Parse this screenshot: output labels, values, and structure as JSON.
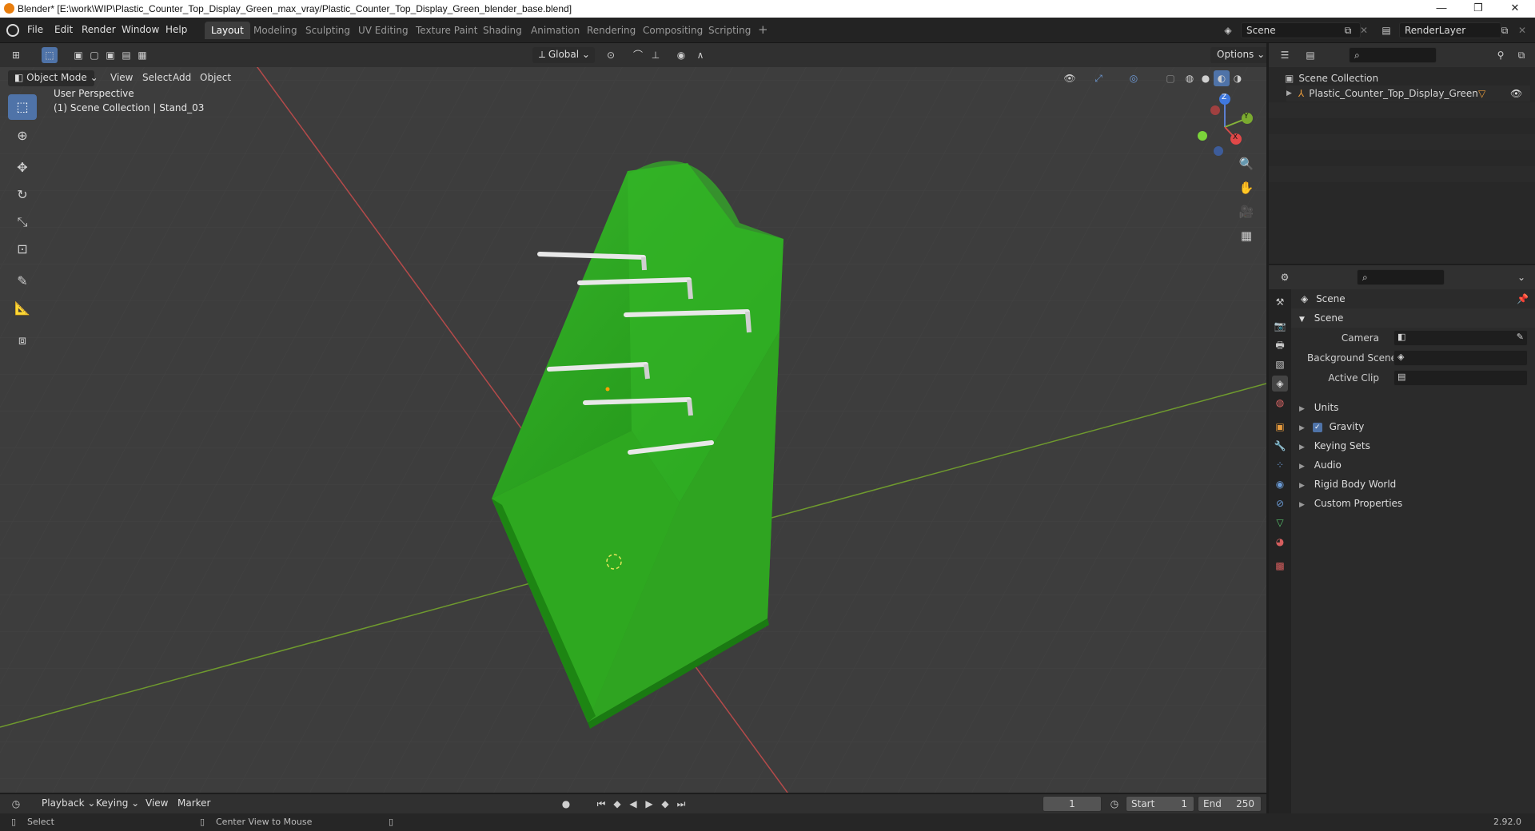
{
  "window": {
    "title": "Blender* [E:\\work\\WIP\\Plastic_Counter_Top_Display_Green_max_vray/Plastic_Counter_Top_Display_Green_blender_base.blend]",
    "minimize": "—",
    "maximize": "❐",
    "close": "✕"
  },
  "menu": [
    "File",
    "Edit",
    "Render",
    "Window",
    "Help"
  ],
  "workspaces": [
    "Layout",
    "Modeling",
    "Sculpting",
    "UV Editing",
    "Texture Paint",
    "Shading",
    "Animation",
    "Rendering",
    "Compositing",
    "Scripting"
  ],
  "workspace_add": "+",
  "scene_field": "Scene",
  "renderlayer_field": "RenderLayer",
  "viewport": {
    "transform_orientation": "Global",
    "options": "Options",
    "mode": "Object Mode",
    "menus": [
      "View",
      "Select",
      "Add",
      "Object"
    ],
    "perspective": "User Perspective",
    "collection_info": "(1) Scene Collection | Stand_03",
    "gizmo": {
      "z": "Z",
      "y": "Y",
      "x": "X"
    }
  },
  "outliner": {
    "root": "Scene Collection",
    "items": [
      "Plastic_Counter_Top_Display_Green"
    ]
  },
  "properties": {
    "context": "Scene",
    "section": "Scene",
    "fields": [
      {
        "label": "Camera"
      },
      {
        "label": "Background Scene"
      },
      {
        "label": "Active Clip"
      }
    ],
    "panels": [
      "Units",
      "Gravity",
      "Keying Sets",
      "Audio",
      "Rigid Body World",
      "Custom Properties"
    ]
  },
  "timeline": {
    "menus": [
      "Playback",
      "Keying",
      "View",
      "Marker"
    ],
    "current_frame": "1",
    "start_label": "Start",
    "start": "1",
    "end_label": "End",
    "end": "250"
  },
  "status": {
    "left_action": "Select",
    "middle_action": "Center View to Mouse",
    "version": "2.92.0"
  },
  "colors": {
    "accent": "#4f73a8",
    "model_green": "#2fae1e",
    "axis_x": "#c84a4a",
    "axis_y": "#7aa235"
  }
}
